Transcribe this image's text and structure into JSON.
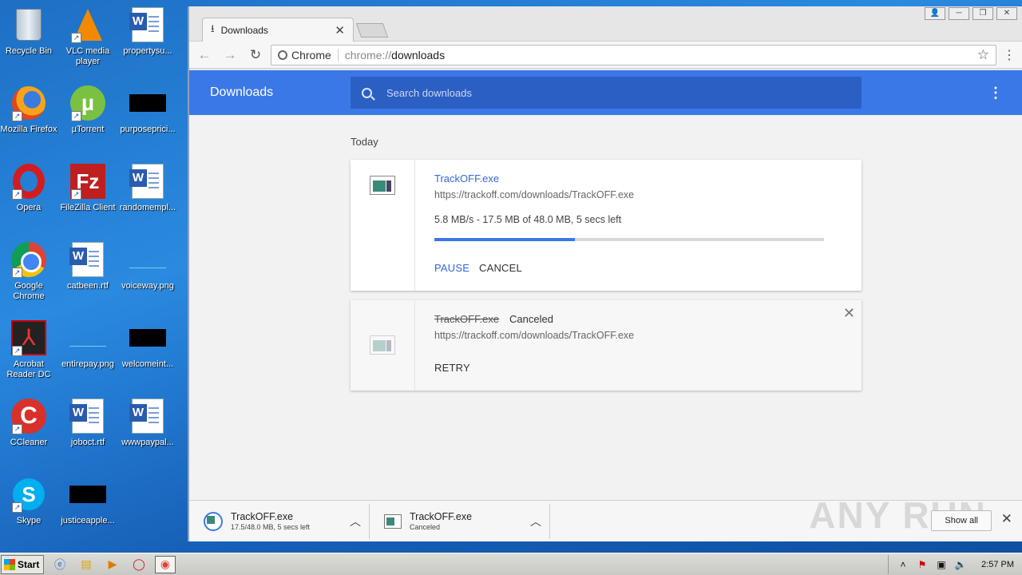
{
  "desktop": {
    "icons": [
      {
        "label": "Recycle Bin"
      },
      {
        "label": "VLC media player"
      },
      {
        "label": "propertysu..."
      },
      {
        "label": "Mozilla Firefox"
      },
      {
        "label": "µTorrent"
      },
      {
        "label": "purposeprici..."
      },
      {
        "label": "Opera"
      },
      {
        "label": "FileZilla Client"
      },
      {
        "label": "randomempl..."
      },
      {
        "label": "Google Chrome"
      },
      {
        "label": "catbeen.rtf"
      },
      {
        "label": "voiceway.png"
      },
      {
        "label": "Acrobat Reader DC"
      },
      {
        "label": "entirepay.png"
      },
      {
        "label": "welcomeint..."
      },
      {
        "label": "CCleaner"
      },
      {
        "label": "joboct.rtf"
      },
      {
        "label": "wwwpaypal..."
      },
      {
        "label": "Skype"
      },
      {
        "label": "justiceapple..."
      }
    ]
  },
  "browser": {
    "tab_title": "Downloads",
    "site_label": "Chrome",
    "url_scheme": "chrome://",
    "url_path": "downloads"
  },
  "downloads_page": {
    "title": "Downloads",
    "search_placeholder": "Search downloads",
    "section": "Today",
    "items": [
      {
        "filename": "TrackOFF.exe",
        "url": "https://trackoff.com/downloads/TrackOFF.exe",
        "status": "5.8 MB/s - 17.5 MB of 48.0 MB, 5 secs left",
        "progress": 0.36,
        "actions": [
          "PAUSE",
          "CANCEL"
        ]
      },
      {
        "filename": "TrackOFF.exe",
        "state": "Canceled",
        "url": "https://trackoff.com/downloads/TrackOFF.exe",
        "actions": [
          "RETRY"
        ]
      }
    ]
  },
  "shelf": {
    "items": [
      {
        "name": "TrackOFF.exe",
        "sub": "17.5/48.0 MB, 5 secs left"
      },
      {
        "name": "TrackOFF.exe",
        "sub": "Canceled"
      }
    ],
    "show_all": "Show all"
  },
  "watermark": "ANY RUN",
  "taskbar": {
    "start_label": "Start",
    "clock": "2:57 PM"
  },
  "colors": {
    "header_blue": "#3b78e7",
    "link_blue": "#3367d6"
  }
}
